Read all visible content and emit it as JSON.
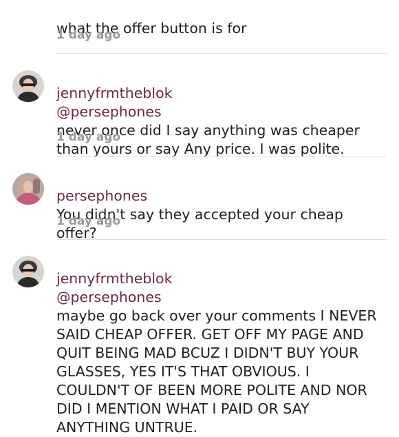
{
  "comments": [
    {
      "username": "",
      "mention": "",
      "text": "what the offer button is for",
      "time": "1 day ago"
    },
    {
      "username": "jennyfrmtheblok",
      "mention": "@persephones",
      "text": "never once did I say anything was cheaper than yours or say Any price. I was polite.",
      "time": "1 day ago"
    },
    {
      "username": "persephones",
      "mention": "",
      "text": "You didn't say they accepted your cheap offer?",
      "time": "1 day ago"
    },
    {
      "username": "jennyfrmtheblok",
      "mention": "@persephones",
      "text": "maybe go back over your comments I NEVER SAID CHEAP OFFER. GET OFF MY PAGE AND QUIT BEING MAD BCUZ I DIDN'T BUY YOUR GLASSES,  YES IT'S THAT OBVIOUS. I COULDN'T OF BEEN MORE POLITE AND NOR DID I MENTION WHAT I PAID OR SAY ANYTHING UNTRUE.",
      "time": ""
    }
  ]
}
